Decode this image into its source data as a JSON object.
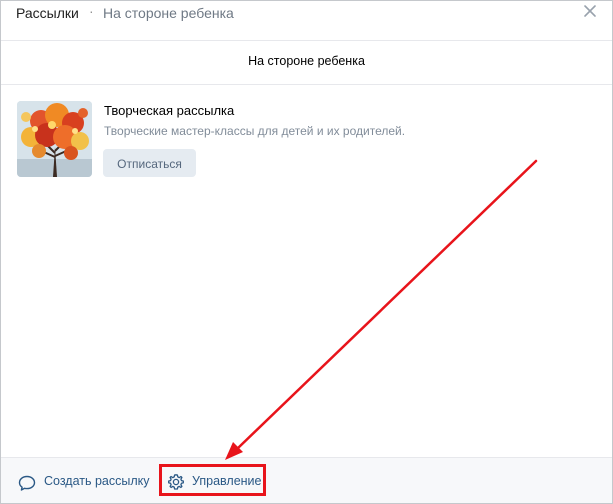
{
  "header": {
    "breadcrumb_root": "Рассылки",
    "breadcrumb_separator": "·",
    "breadcrumb_current": "На стороне ребенка",
    "close_icon": "close-icon"
  },
  "subheader": {
    "title": "На стороне ребенка"
  },
  "item": {
    "title": "Творческая рассылка",
    "description": "Творческие мастер-классы для детей и их родителей.",
    "unsubscribe_label": "Отписаться",
    "thumbnail_icon": "autumn-tree-painting"
  },
  "footer": {
    "create_label": "Создать рассылку",
    "create_icon": "comment-icon",
    "manage_label": "Управление",
    "manage_icon": "settings-icon"
  },
  "colors": {
    "link": "#2a5885",
    "button_bg": "#e5ebf1",
    "button_text": "#55677d",
    "muted_text": "#818c99",
    "annotation_red": "#e8141b"
  }
}
